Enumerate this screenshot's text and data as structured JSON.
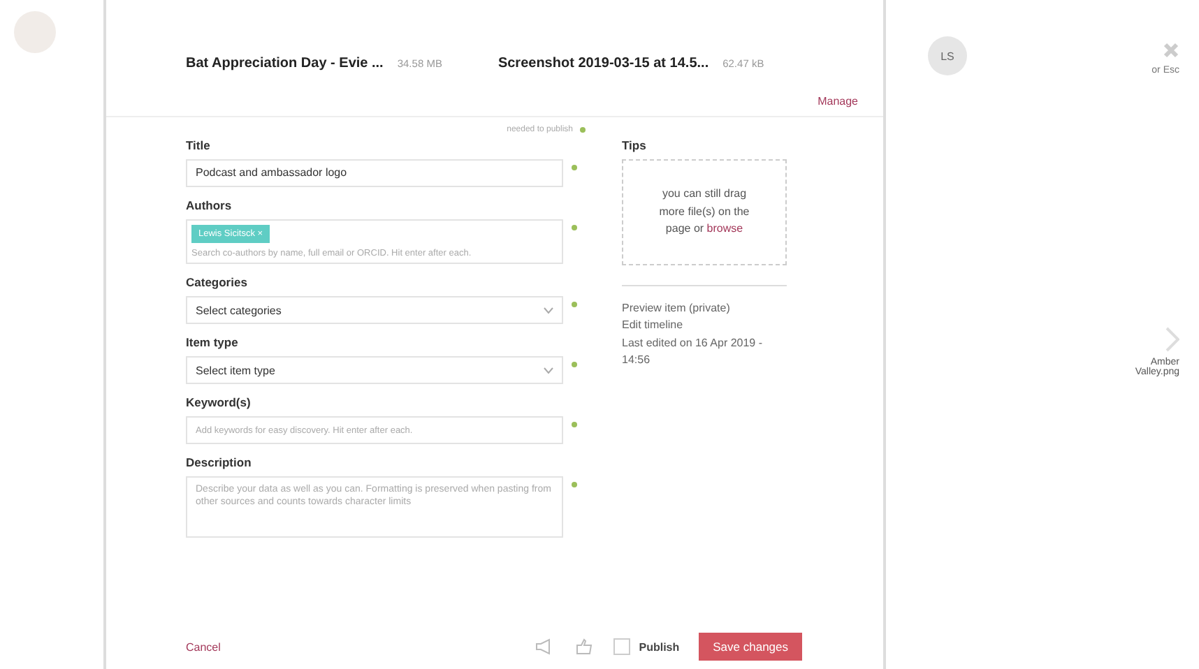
{
  "files": [
    {
      "name": "Bat Appreciation Day - Evie ...",
      "size": "34.58 MB"
    },
    {
      "name": "Screenshot 2019-03-15 at 14.5...",
      "size": "62.47 kB"
    }
  ],
  "manage_link": "Manage",
  "legend": "needed to publish",
  "fields": [
    {
      "kind": "text",
      "label": "Title",
      "value": "Podcast and ambassador logo",
      "required": true
    },
    {
      "kind": "tags",
      "label": "Authors",
      "tags": [
        "Lewis Sicitsck ×"
      ],
      "placeholder": "Search co-authors by name, full email or ORCID. Hit enter after each.",
      "required": true
    },
    {
      "kind": "select",
      "label": "Categories",
      "value": "Select categories",
      "required": true
    },
    {
      "kind": "select",
      "label": "Item type",
      "value": "Select item type",
      "required": true
    },
    {
      "kind": "text",
      "label": "Keyword(s)",
      "placeholder": "Add keywords for easy discovery. Hit enter after each.",
      "required": true
    },
    {
      "kind": "textarea",
      "label": "Description",
      "placeholder": "Describe your data as well as you can. Formatting is preserved when pasting from other sources and counts towards character limits",
      "required": true
    }
  ],
  "tips": {
    "title": "Tips",
    "drop_text": "you can still drag more file(s) on the page or",
    "browse_link": "browse"
  },
  "side_links": [
    "Preview item (private)",
    "Edit timeline"
  ],
  "last_edited": "Last edited on 16 Apr 2019 - 14:56",
  "footer": {
    "cancel": "Cancel",
    "publish": {
      "label": "Publish",
      "checked": false
    },
    "save": "Save changes"
  },
  "close": {
    "hint": "or Esc"
  },
  "avatar": "LS",
  "next_file": "Amber Valley.png"
}
